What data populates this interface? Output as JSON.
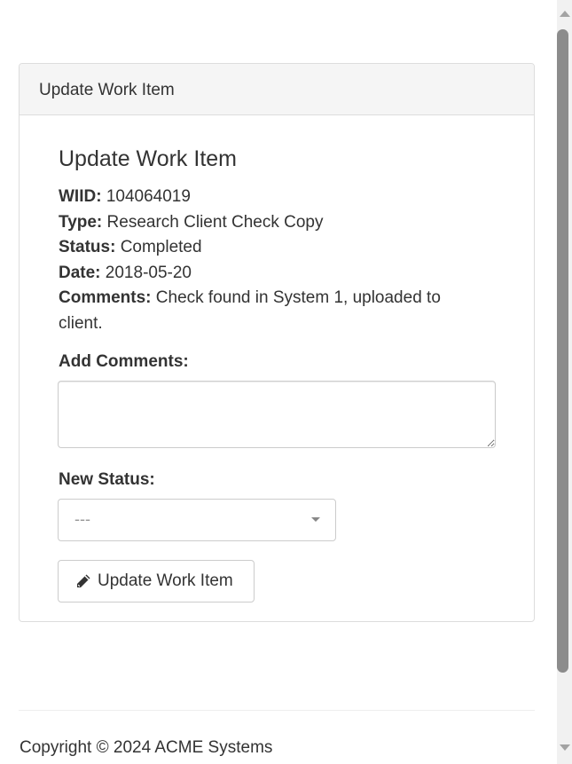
{
  "panel": {
    "heading": "Update Work Item",
    "title": "Update Work Item"
  },
  "work_item": {
    "wiid_label": "WIID:",
    "wiid": "104064019",
    "type_label": "Type:",
    "type": "Research Client Check Copy",
    "status_label": "Status:",
    "status": "Completed",
    "date_label": "Date:",
    "date": "2018-05-20",
    "comments_label": "Comments:",
    "comments": "Check found in System 1, uploaded to client."
  },
  "form": {
    "add_comments_label": "Add Comments:",
    "add_comments_value": "",
    "new_status_label": "New Status:",
    "new_status_selected": "---",
    "submit_label": "Update Work Item",
    "submit_icon": "pencil-icon"
  },
  "footer": {
    "copyright": "Copyright © 2024 ACME Systems"
  },
  "colors": {
    "panel_heading_bg": "#f5f5f5",
    "border": "#dddddd",
    "text": "#333333",
    "scroll_thumb": "#8c8c8c"
  }
}
